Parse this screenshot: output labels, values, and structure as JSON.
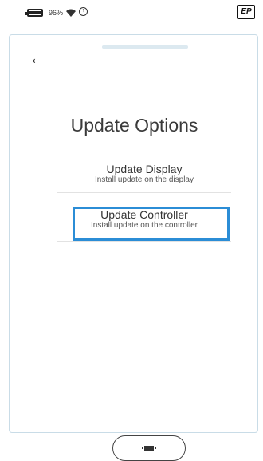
{
  "status": {
    "battery_percent": "96%",
    "icons": [
      "battery-icon",
      "wifi-icon",
      "sync-icon"
    ],
    "logo_text": "EP"
  },
  "page": {
    "title": "Update Options",
    "back_icon": "back-arrow-icon"
  },
  "options": [
    {
      "title": "Update Display",
      "subtitle": "Install update on the display",
      "selected": false
    },
    {
      "title": "Update Controller",
      "subtitle": "Install update on the controller",
      "selected": true
    }
  ],
  "colors": {
    "highlight": "#2b8dd6",
    "frame": "#c9dce7"
  },
  "home_button_icon": "home-icon"
}
